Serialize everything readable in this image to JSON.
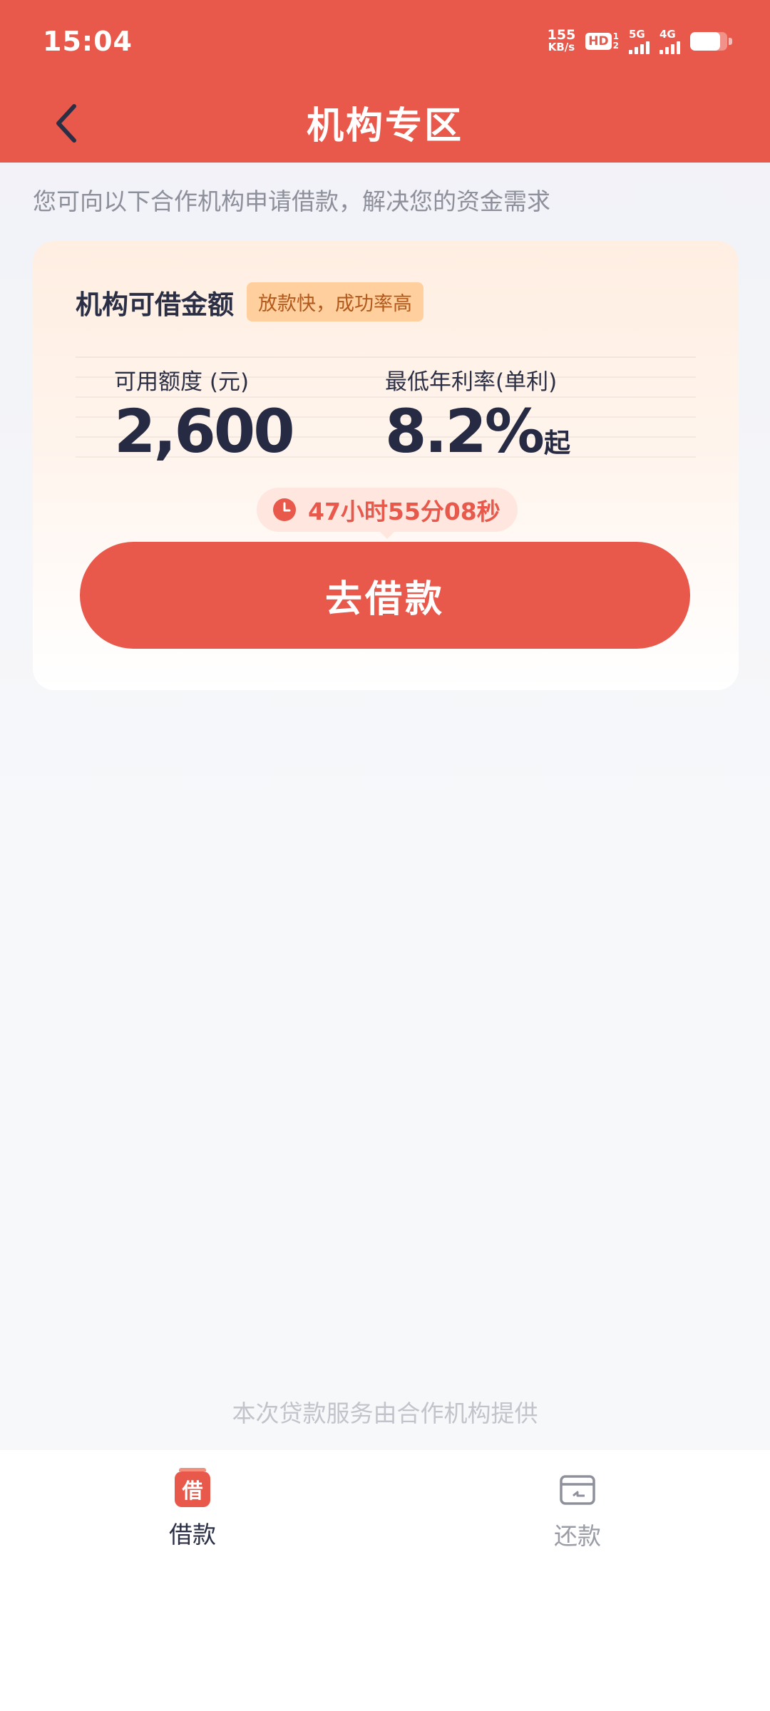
{
  "status_bar": {
    "time": "15:04",
    "net_speed": "155",
    "net_unit": "KB/s",
    "hd_label": "HD",
    "hd_sub_top": "1",
    "hd_sub_bottom": "2",
    "sim1_label": "5G",
    "sim2_label": "4G",
    "battery_level": 0.8
  },
  "header": {
    "back_icon": "chevron-left-icon",
    "title": "机构专区"
  },
  "subtitle": "您可向以下合作机构申请借款，解决您的资金需求",
  "card": {
    "title": "机构可借金额",
    "tag": "放款快，成功率高",
    "stats": [
      {
        "label": "可用额度 (元)",
        "value": "2,600",
        "suffix": ""
      },
      {
        "label": "最低年利率(单利)",
        "value": "8.2%",
        "suffix": "起"
      }
    ],
    "countdown_icon": "clock-icon",
    "countdown": "47小时55分08秒",
    "cta_label": "去借款"
  },
  "footer_note": "本次贷款服务由合作机构提供",
  "tabbar": {
    "items": [
      {
        "label": "借款",
        "icon_text": "借",
        "icon": "borrow-icon",
        "active": true
      },
      {
        "label": "还款",
        "icon": "repay-card-icon",
        "active": false
      }
    ]
  },
  "colors": {
    "brand": "#e8584b",
    "tag_bg": "#ffcf9e",
    "tag_text": "#b2591b",
    "text_dark": "#2b2f45",
    "text_muted": "#8d8f9a"
  }
}
